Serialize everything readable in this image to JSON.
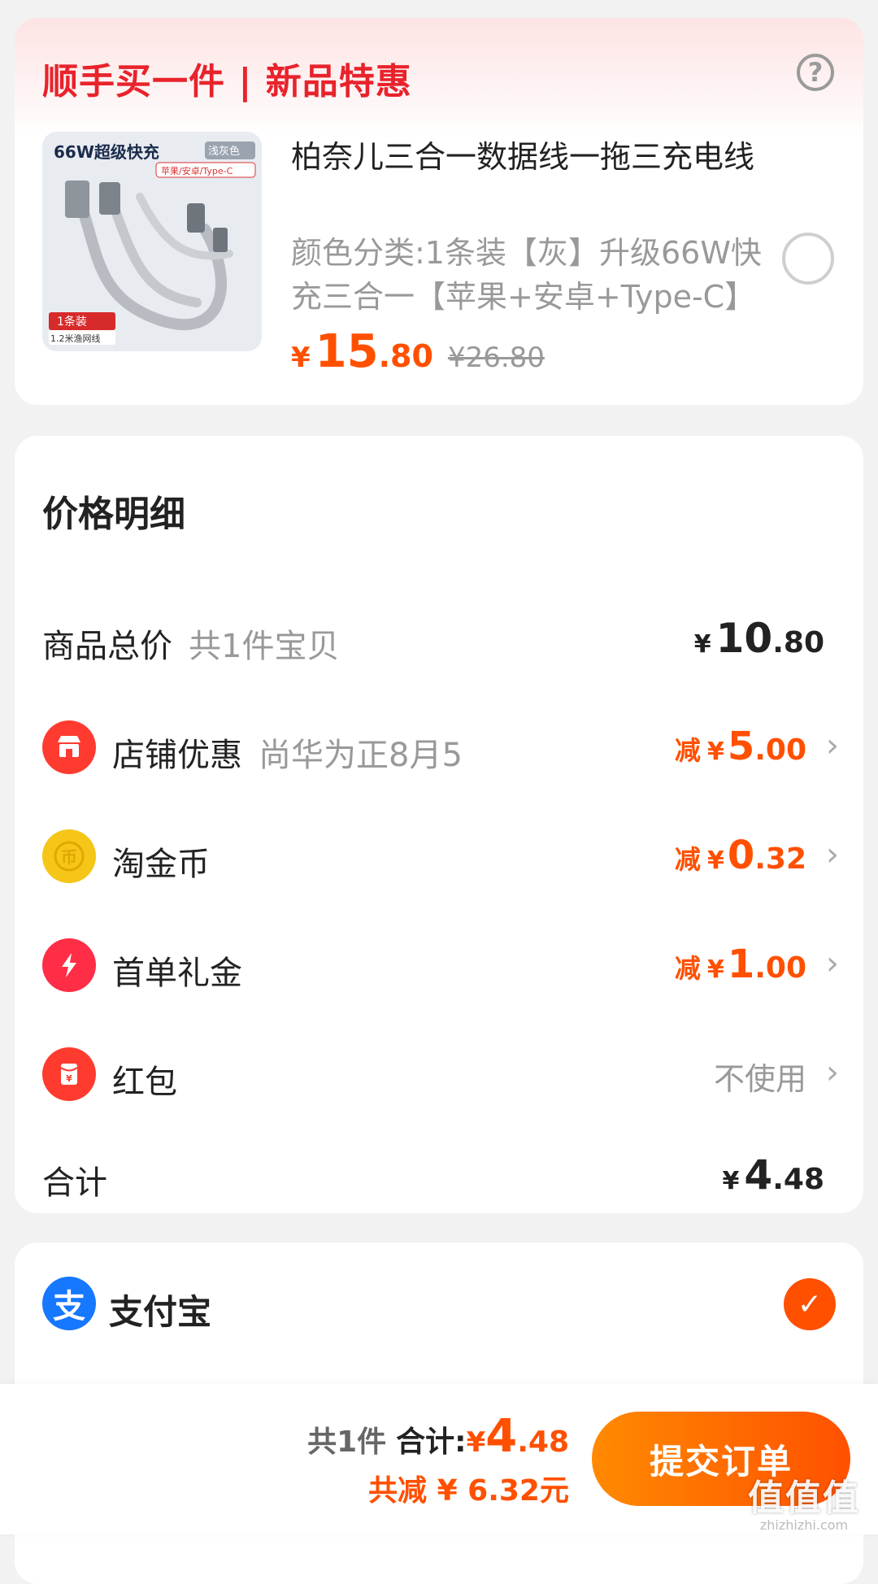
{
  "addon": {
    "title": "顺手买一件 | 新品特惠",
    "help_icon": "?",
    "product": {
      "image_badge_title": "66W超级快充",
      "image_badge_color": "浅灰色",
      "image_badge_ports": "苹果/安卓/Type-C",
      "image_badge_pack": "1条装",
      "image_badge_length": "1.2米渔网线",
      "name": "柏奈儿三合一数据线一拖三充电线",
      "spec": "颜色分类:1条装【灰】升级66W快充三合一【苹果+安卓+Type-C】",
      "price_yen": "¥",
      "price_int": "15",
      "price_dec": ".80",
      "original_price": "¥26.80"
    }
  },
  "details": {
    "title": "价格明细",
    "total": {
      "label": "商品总价",
      "sub": "共1件宝贝",
      "yen": "¥",
      "int": "10",
      "dec": ".80"
    },
    "store_discount": {
      "label": "店铺优惠",
      "sub": "尚华为正8月5",
      "prefix": "减",
      "yen": "¥",
      "int": "5",
      "dec": ".00"
    },
    "coins": {
      "label": "淘金币",
      "prefix": "减",
      "yen": "¥",
      "int": "0",
      "dec": ".32"
    },
    "first_order": {
      "label": "首单礼金",
      "prefix": "减",
      "yen": "¥",
      "int": "1",
      "dec": ".00"
    },
    "red_packet": {
      "label": "红包",
      "value": "不使用"
    },
    "sum": {
      "label": "合计",
      "yen": "¥",
      "int": "4",
      "dec": ".48"
    },
    "chevron": "›"
  },
  "payment": {
    "label": "支付宝",
    "icon_char": "支",
    "check": "✓"
  },
  "bottom": {
    "count": "共1件",
    "label": "合计:",
    "yen": "¥",
    "int": "4",
    "dec": ".48",
    "saved": "共减 ¥ 6.32元",
    "submit": "提交订单"
  },
  "watermark": {
    "logo": "值值值",
    "url": "zhizhizhi.com"
  },
  "colors": {
    "accent": "#ff5000",
    "title_red": "#e8232c",
    "alipay": "#1677ff",
    "coin": "#f5c518"
  }
}
